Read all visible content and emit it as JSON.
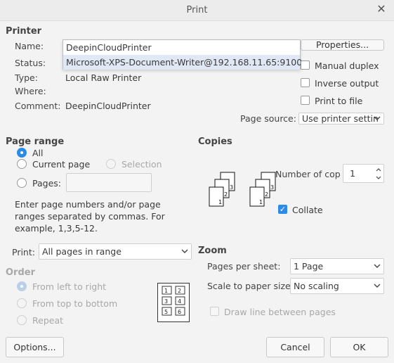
{
  "window": {
    "title": "Print"
  },
  "printer": {
    "heading": "Printer",
    "name_label": "Name:",
    "name_options": [
      "DeepinCloudPrinter",
      "Microsoft-XPS-Document-Writer@192.168.11.65:9100"
    ],
    "properties_button": "Properties...",
    "status_label": "Status:",
    "type_label": "Type:",
    "type_value": "Local Raw Printer",
    "where_label": "Where:",
    "comment_label": "Comment:",
    "comment_value": "DeepinCloudPrinter",
    "manual_duplex": "Manual duplex",
    "inverse_output": "Inverse output",
    "print_to_file": "Print to file",
    "page_source_label": "Page source:",
    "page_source_value": "Use printer settin"
  },
  "page_range": {
    "heading": "Page range",
    "all": "All",
    "current_page": "Current page",
    "selection": "Selection",
    "pages": "Pages:",
    "help": "Enter page numbers and/or page ranges separated by commas. For example, 1,3,5-12.",
    "print_label": "Print:",
    "print_value": "All pages in range"
  },
  "copies": {
    "heading": "Copies",
    "number_label": "Number of cop",
    "number_value": "1",
    "collate": "Collate",
    "collate_checked": true
  },
  "order": {
    "heading": "Order",
    "left_to_right": "From left to right",
    "top_to_bottom": "From top to bottom",
    "repeat": "Repeat"
  },
  "zoom": {
    "heading": "Zoom",
    "pages_per_sheet_label": "Pages per sheet:",
    "pages_per_sheet_value": "1 Page",
    "scale_label": "Scale to paper size:",
    "scale_value": "No scaling",
    "draw_lines": "Draw line between pages"
  },
  "buttons": {
    "options": "Options...",
    "cancel": "Cancel",
    "ok": "OK"
  },
  "icons": {
    "close": "close-icon",
    "collate_pages": "collate-pages-icon",
    "layout_grid": "page-layout-icon"
  }
}
